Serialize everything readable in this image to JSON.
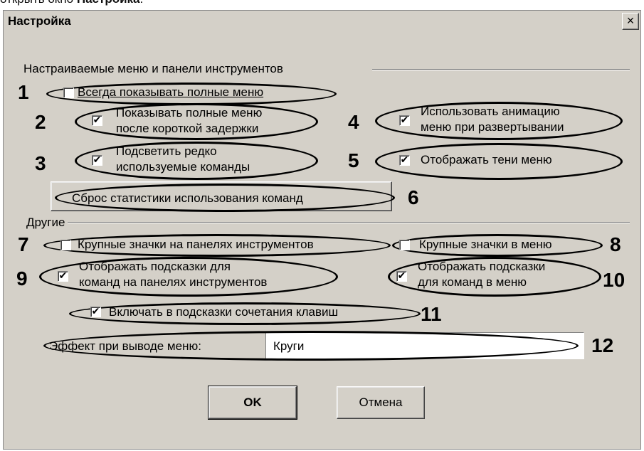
{
  "caption": {
    "prefix": "открыть окно ",
    "bold": "Настройка",
    "suffix": "."
  },
  "window": {
    "title": "Настройка",
    "close_glyph": "×"
  },
  "group_menus": {
    "label": "Настраиваемые меню и панели инструментов"
  },
  "group_other": {
    "label": "Другие"
  },
  "options": {
    "always_full_menus": {
      "number": "1",
      "label": "Всегда показывать полные меню",
      "checked": false
    },
    "full_menus_delay": {
      "number": "2",
      "line1": "Показывать полные меню",
      "line2": "после короткой задержки",
      "checked": true
    },
    "highlight_rare": {
      "number": "3",
      "line1": "Подсветить редко",
      "line2": "используемые команды",
      "checked": true
    },
    "menu_animation": {
      "number": "4",
      "line1": "Использовать анимацию",
      "line2": "меню при развертывании",
      "checked": true
    },
    "menu_shadows": {
      "number": "5",
      "label": "Отображать тени меню",
      "checked": true
    },
    "reset_stats": {
      "number": "6",
      "label": "Сброс статистики использования команд"
    },
    "large_toolbar_icons": {
      "number": "7",
      "label": "Крупные значки на панелях инструментов",
      "checked": false
    },
    "large_menu_icons": {
      "number": "8",
      "label": "Крупные значки в меню",
      "checked": false
    },
    "toolbar_tooltips": {
      "number": "9",
      "line1": "Отображать подсказки для",
      "line2": "команд на панелях инструментов",
      "checked": true
    },
    "menu_tooltips": {
      "number": "10",
      "line1": "Отображать подсказки",
      "line2": "для команд в меню",
      "checked": true
    },
    "tooltip_shortcuts": {
      "number": "11",
      "label": "Включать в подсказки сочетания клавиш",
      "checked": true
    },
    "menu_effect": {
      "number": "12",
      "label": "Эффект при выводе меню:",
      "value": "Круги"
    }
  },
  "buttons": {
    "ok": "OK",
    "cancel": "Отмена"
  },
  "check_glyph": "✔"
}
